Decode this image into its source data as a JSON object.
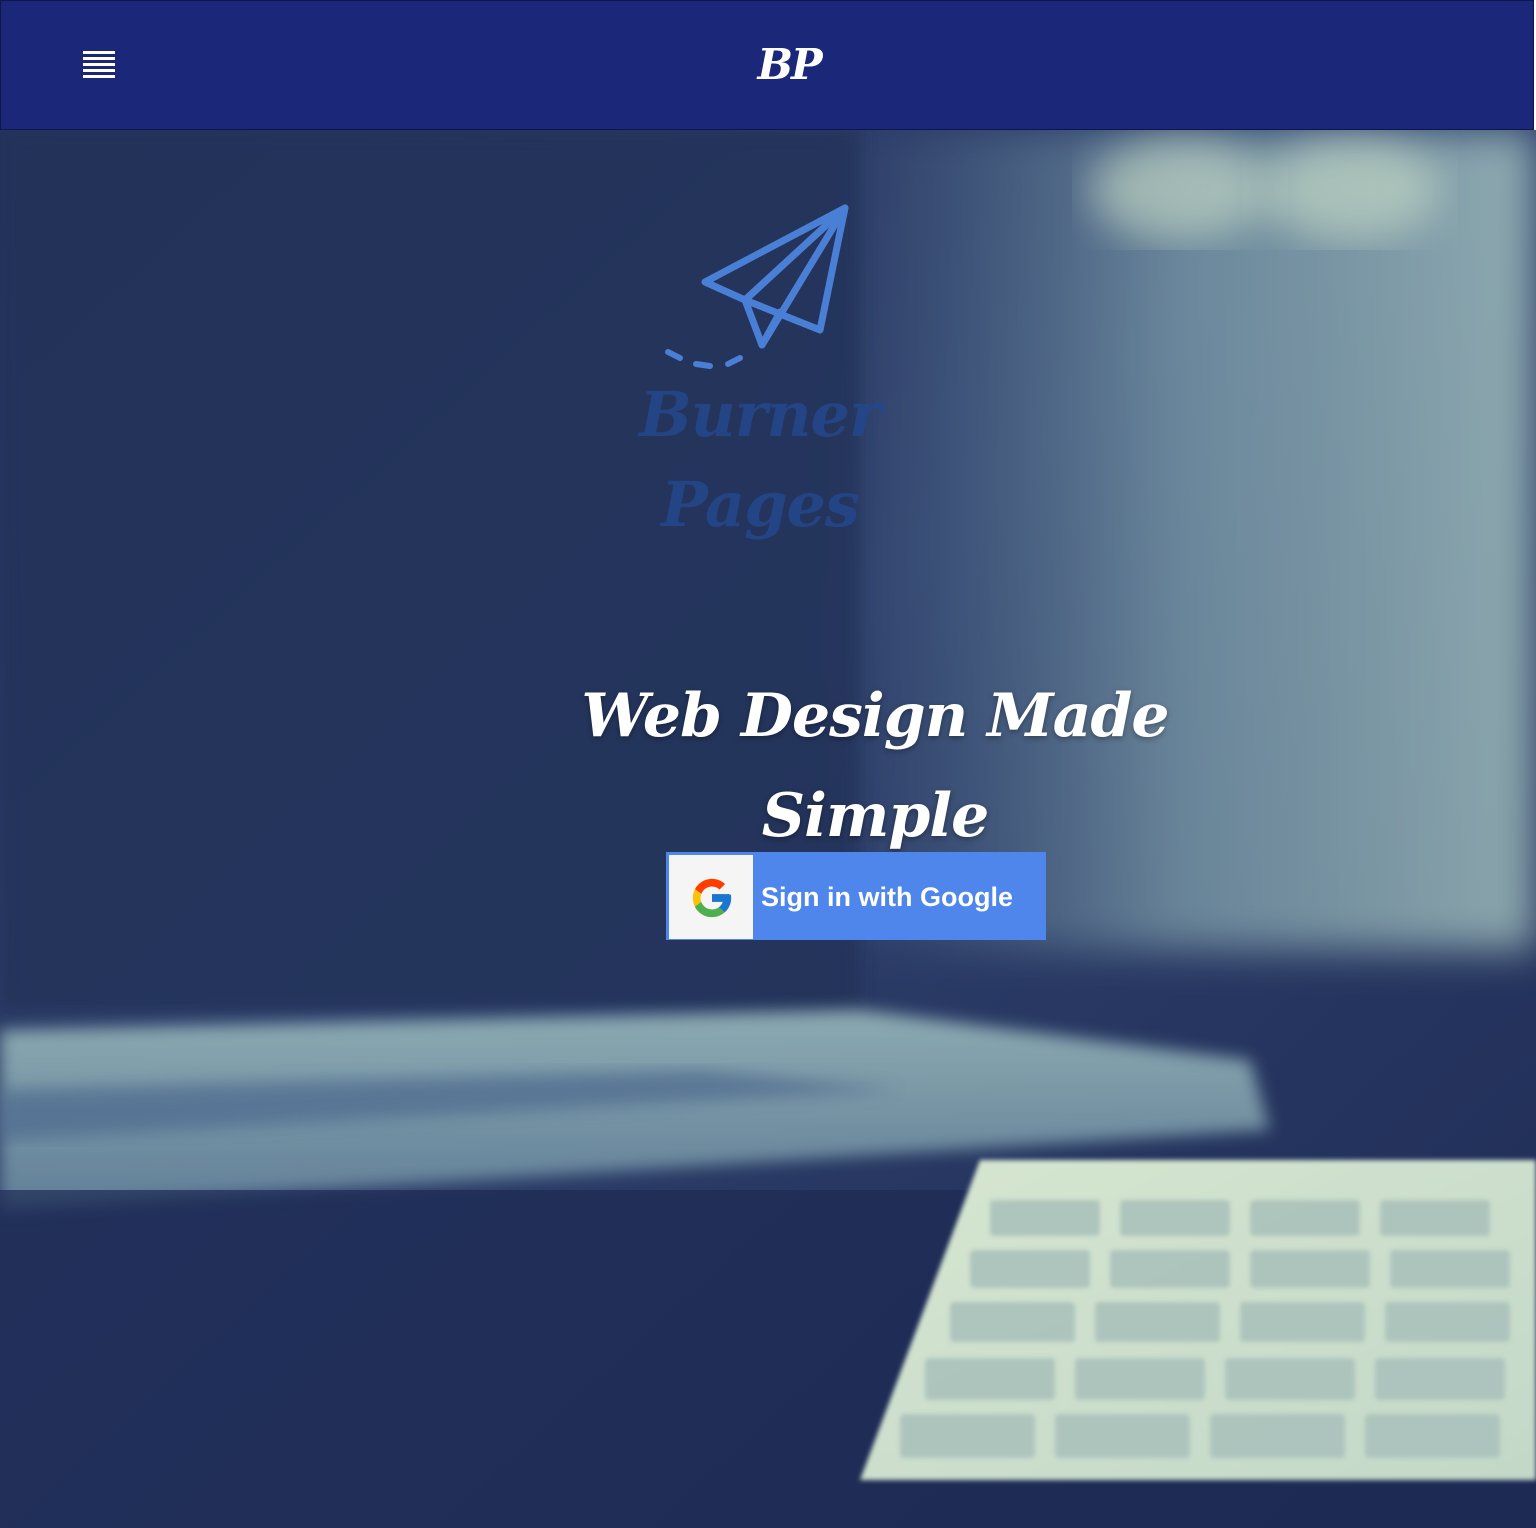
{
  "navbar": {
    "menu_icon": "hamburger-menu-icon",
    "logo_text": "BP",
    "background_color": "#1b2779"
  },
  "hero": {
    "brand_icon": "paper-plane-icon",
    "brand_name": "Burner Pages",
    "tagline": "Web Design Made Simple",
    "signin_button": {
      "icon": "google-g-icon",
      "label": "Sign in with Google",
      "color": "#4f86ec"
    },
    "background_image": "laptop-keyboard-photo"
  }
}
